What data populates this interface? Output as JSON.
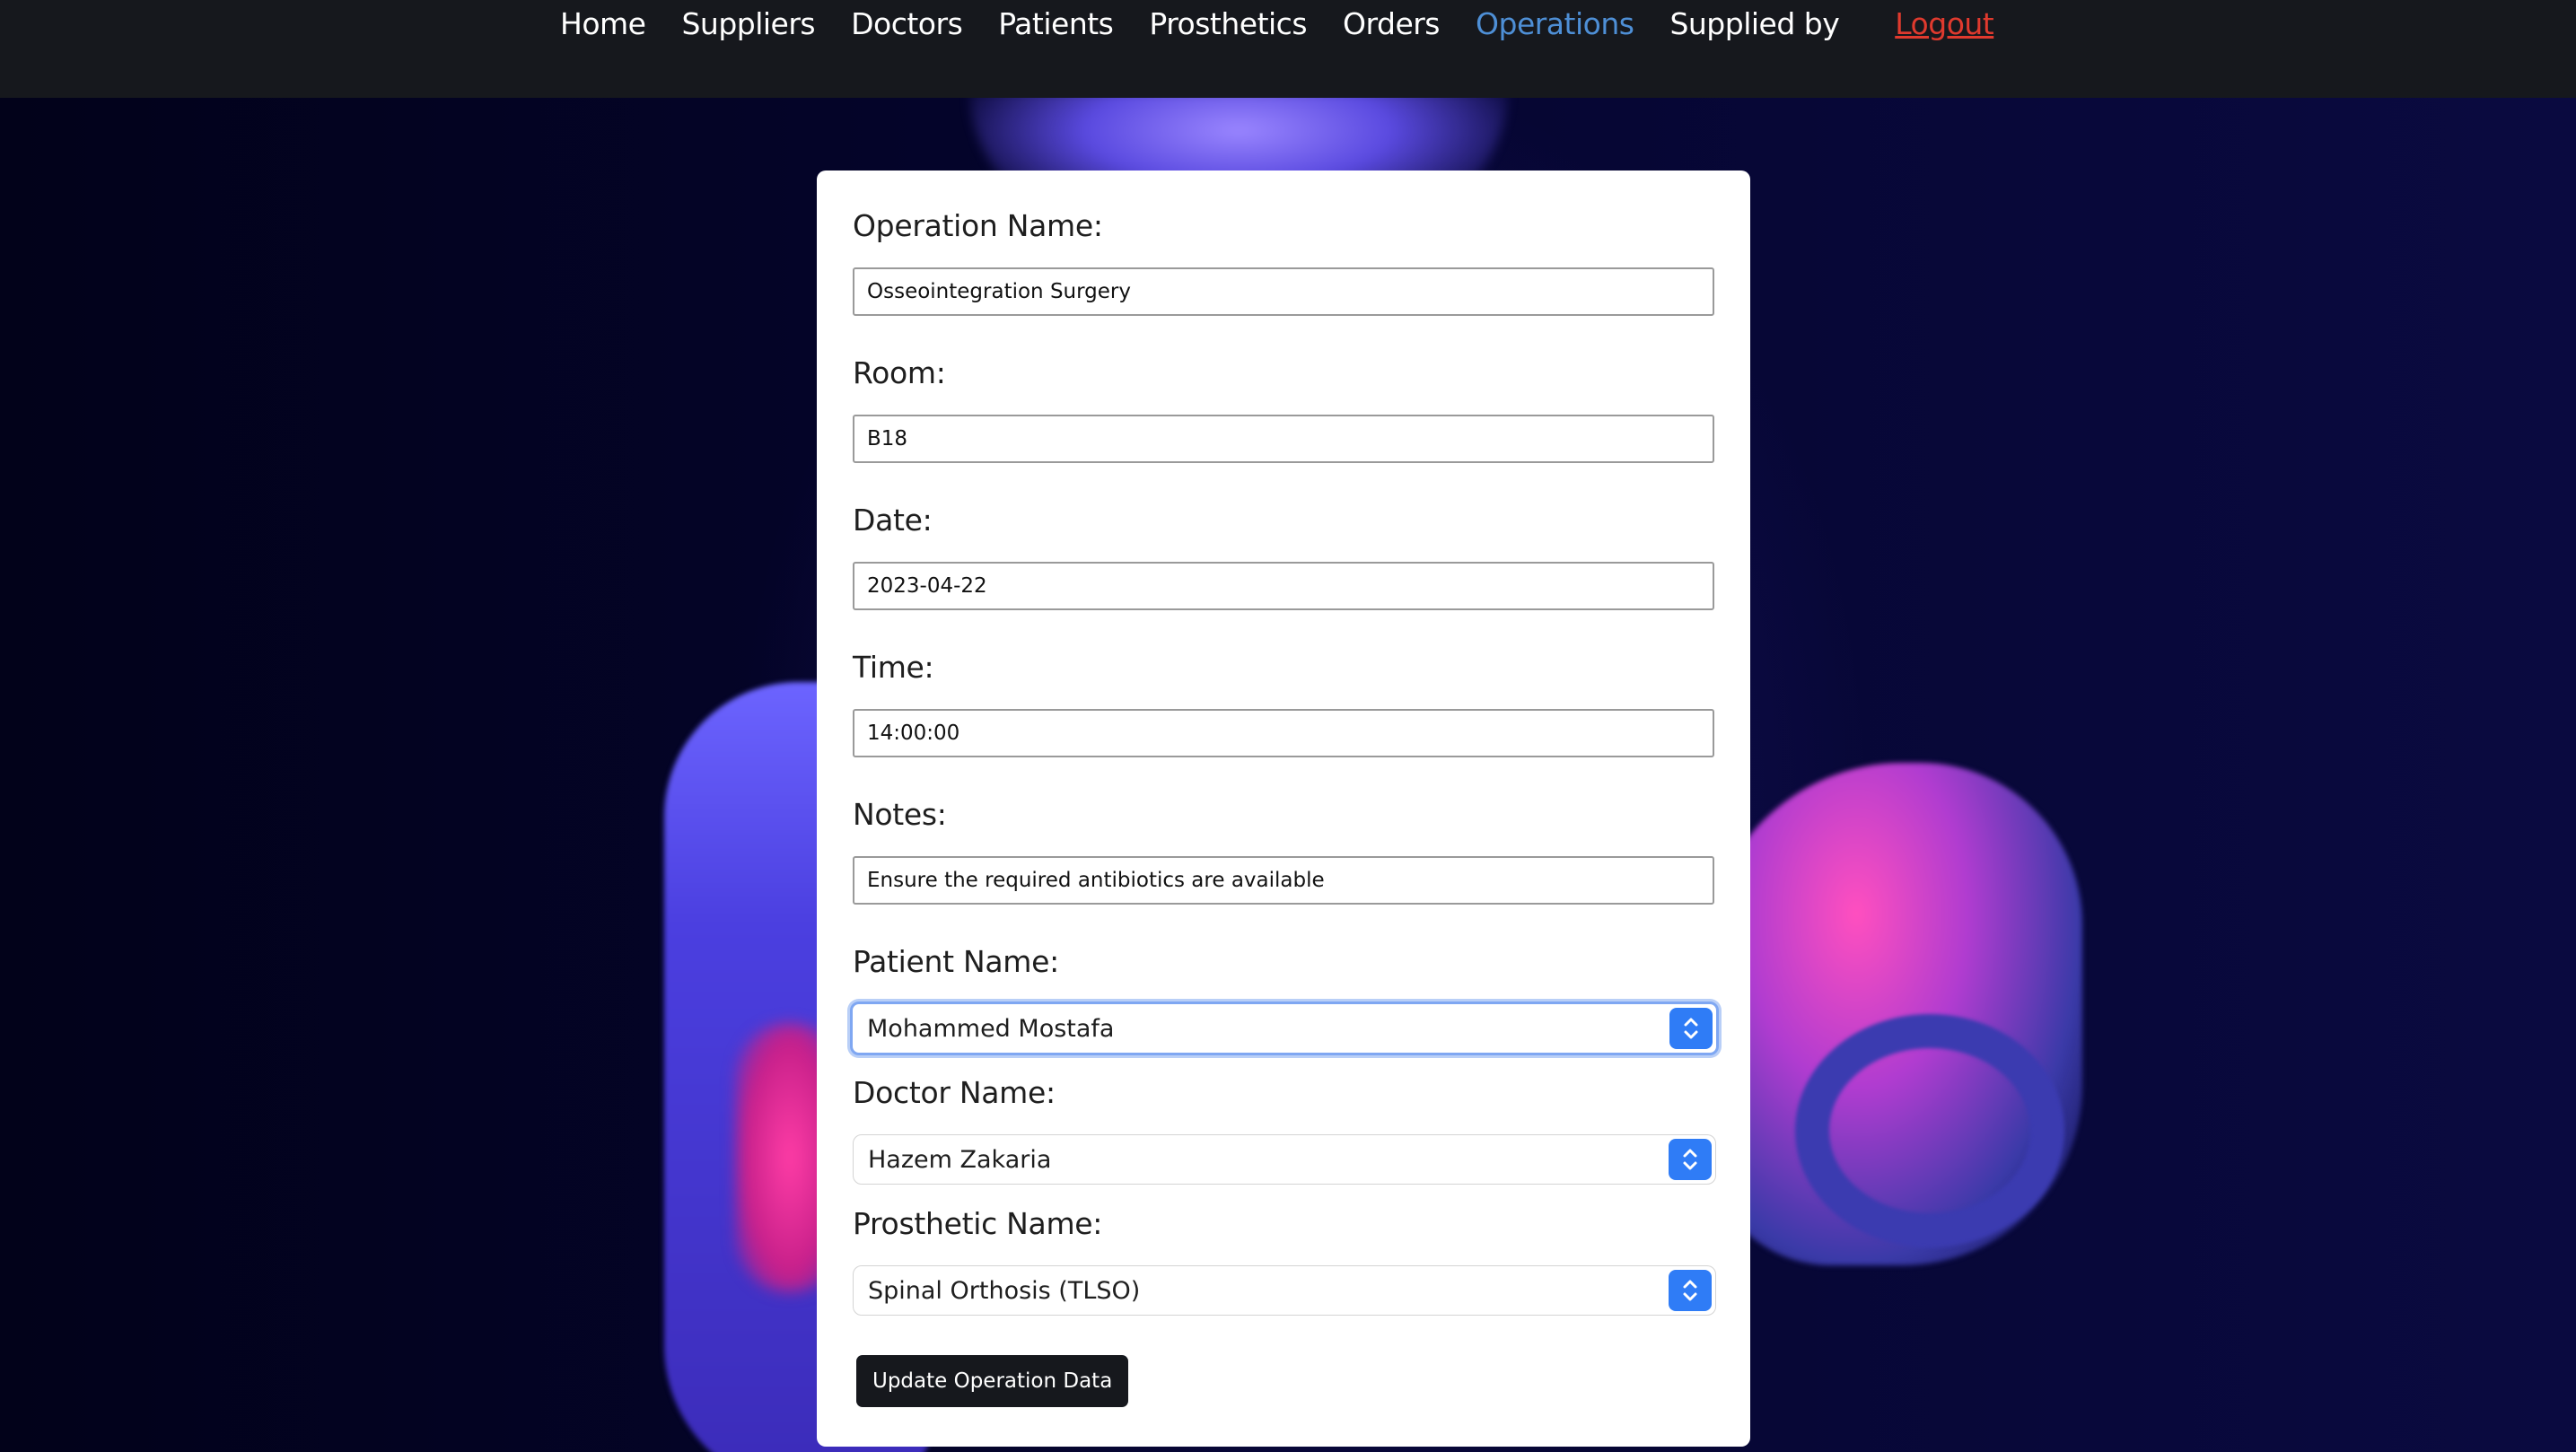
{
  "nav": {
    "items": [
      {
        "label": "Home"
      },
      {
        "label": "Suppliers"
      },
      {
        "label": "Doctors"
      },
      {
        "label": "Patients"
      },
      {
        "label": "Prosthetics"
      },
      {
        "label": "Orders"
      },
      {
        "label": "Operations",
        "active": true
      },
      {
        "label": "Supplied by"
      }
    ],
    "logout_label": "Logout",
    "active_color": "#4e8fd6",
    "logout_color": "#e03a2e"
  },
  "form": {
    "operation_name": {
      "label": "Operation Name:",
      "value": "Osseointegration Surgery"
    },
    "room": {
      "label": "Room:",
      "value": "B18"
    },
    "date": {
      "label": "Date:",
      "value": "2023-04-22"
    },
    "time": {
      "label": "Time:",
      "value": "14:00:00"
    },
    "notes": {
      "label": "Notes:",
      "value": "Ensure the required antibiotics are available"
    },
    "patient_name": {
      "label": "Patient Name:",
      "selected": "Mohammed Mostafa",
      "focused": true
    },
    "doctor_name": {
      "label": "Doctor Name:",
      "selected": "Hazem Zakaria"
    },
    "prosthetic_name": {
      "label": "Prosthetic Name:",
      "selected": "Spinal Orthosis (TLSO)"
    },
    "submit_label": "Update Operation Data"
  },
  "colors": {
    "navbar_bg": "#16181d",
    "select_accent": "#2f7cf6",
    "button_bg": "#16181d"
  }
}
